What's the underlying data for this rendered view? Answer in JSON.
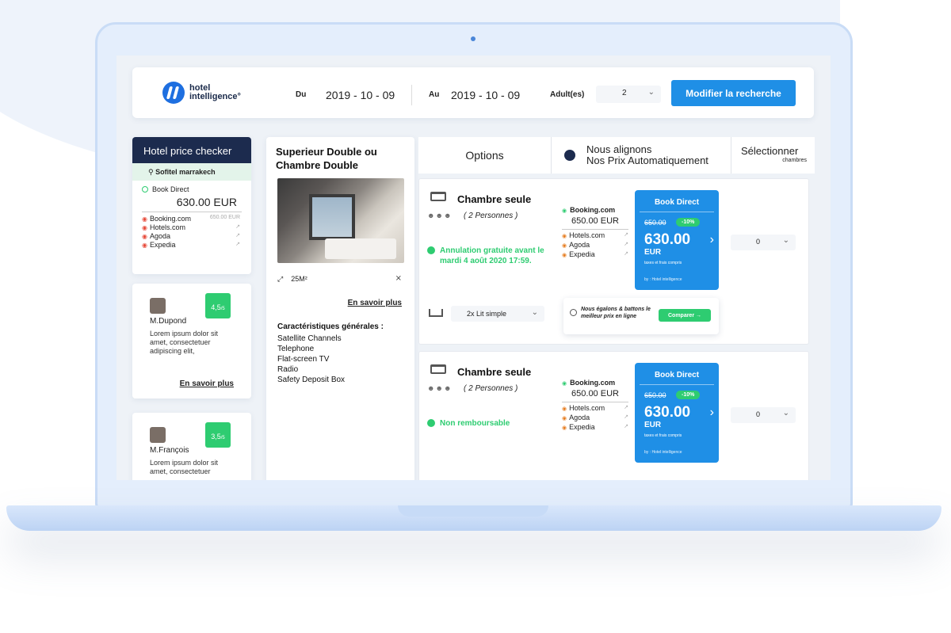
{
  "search": {
    "logo_line1": "hotel",
    "logo_line2": "intelligence°",
    "from_label": "Du",
    "from_date": "2019 - 10 - 09",
    "to_label": "Au",
    "to_date": "2019 - 10 - 09",
    "adults_label": "Adult(es)",
    "adults_value": "2",
    "modify_button": "Modifier la recherche"
  },
  "checker": {
    "title": "Hotel price checker",
    "hotel": "Sofitel marrakech",
    "book_direct": "Book Direct",
    "price": "630.00 EUR",
    "otas": [
      {
        "name": "Booking.com",
        "price": "650.00 EUR"
      },
      {
        "name": "Hotels.com",
        "price": ""
      },
      {
        "name": "Agoda",
        "price": ""
      },
      {
        "name": "Expedia",
        "price": ""
      }
    ]
  },
  "reviews": [
    {
      "name": "M.Dupond",
      "score": "4,5",
      "score_max": "/5",
      "text": "Lorem ipsum dolor sit amet, consectetuer adipiscing elit,",
      "link": "En savoir plus"
    },
    {
      "name": "M.François",
      "score": "3,5",
      "score_max": "/5",
      "text": "Lorem ipsum dolor sit amet, consectetuer",
      "link": ""
    }
  ],
  "room": {
    "title": "Superieur Double ou Chambre Double",
    "area": "25M²",
    "more_link": "En savoir plus",
    "features_title": "Caractéristiques générales :",
    "features": [
      "Satellite Channels",
      "Telephone",
      "Flat-screen TV",
      "Radio",
      "Safety Deposit Box"
    ]
  },
  "options_header": {
    "options": "Options",
    "align_line1": "Nous alignons",
    "align_line2": "Nos Prix Automatiquement",
    "select_line1": "Sélectionner",
    "select_line2": "chambres"
  },
  "rows": [
    {
      "title": "Chambre seule",
      "persons": "( 2 Personnes )",
      "cancel": "Annulation gratuite avant le mardi 4 août 2020 17:59.",
      "booking_name": "Booking.com",
      "booking_price": "650.00 EUR",
      "otas": [
        "Hotels.com",
        "Agoda",
        "Expedia"
      ],
      "bd_title": "Book Direct",
      "bd_old": "650.00",
      "bd_discount": "-10%",
      "bd_price": "630.00",
      "bd_currency": "EUR",
      "bd_taxes": "taxes et frais compris",
      "bd_by": "by : Hotel intelligence",
      "qty": "0",
      "bed": "2x Lit simple",
      "guarantee": "Nous égalons & battons le meilleur prix en ligne",
      "compare": "Comparer →"
    },
    {
      "title": "Chambre seule",
      "persons": "( 2 Personnes )",
      "cancel": "Non remboursable",
      "booking_name": "Booking.com",
      "booking_price": "650.00 EUR",
      "otas": [
        "Hotels.com",
        "Agoda",
        "Expedia"
      ],
      "bd_title": "Book Direct",
      "bd_old": "650.00",
      "bd_discount": "-10%",
      "bd_price": "630.00",
      "bd_currency": "EUR",
      "bd_taxes": "taxes et frais compris",
      "bd_by": "by : Hotel intelligence",
      "qty": "0"
    }
  ],
  "colors": {
    "primary": "#1f8fe6",
    "navy": "#1c2b4e",
    "green": "#2ecc71",
    "lid": "#e4eefc"
  }
}
